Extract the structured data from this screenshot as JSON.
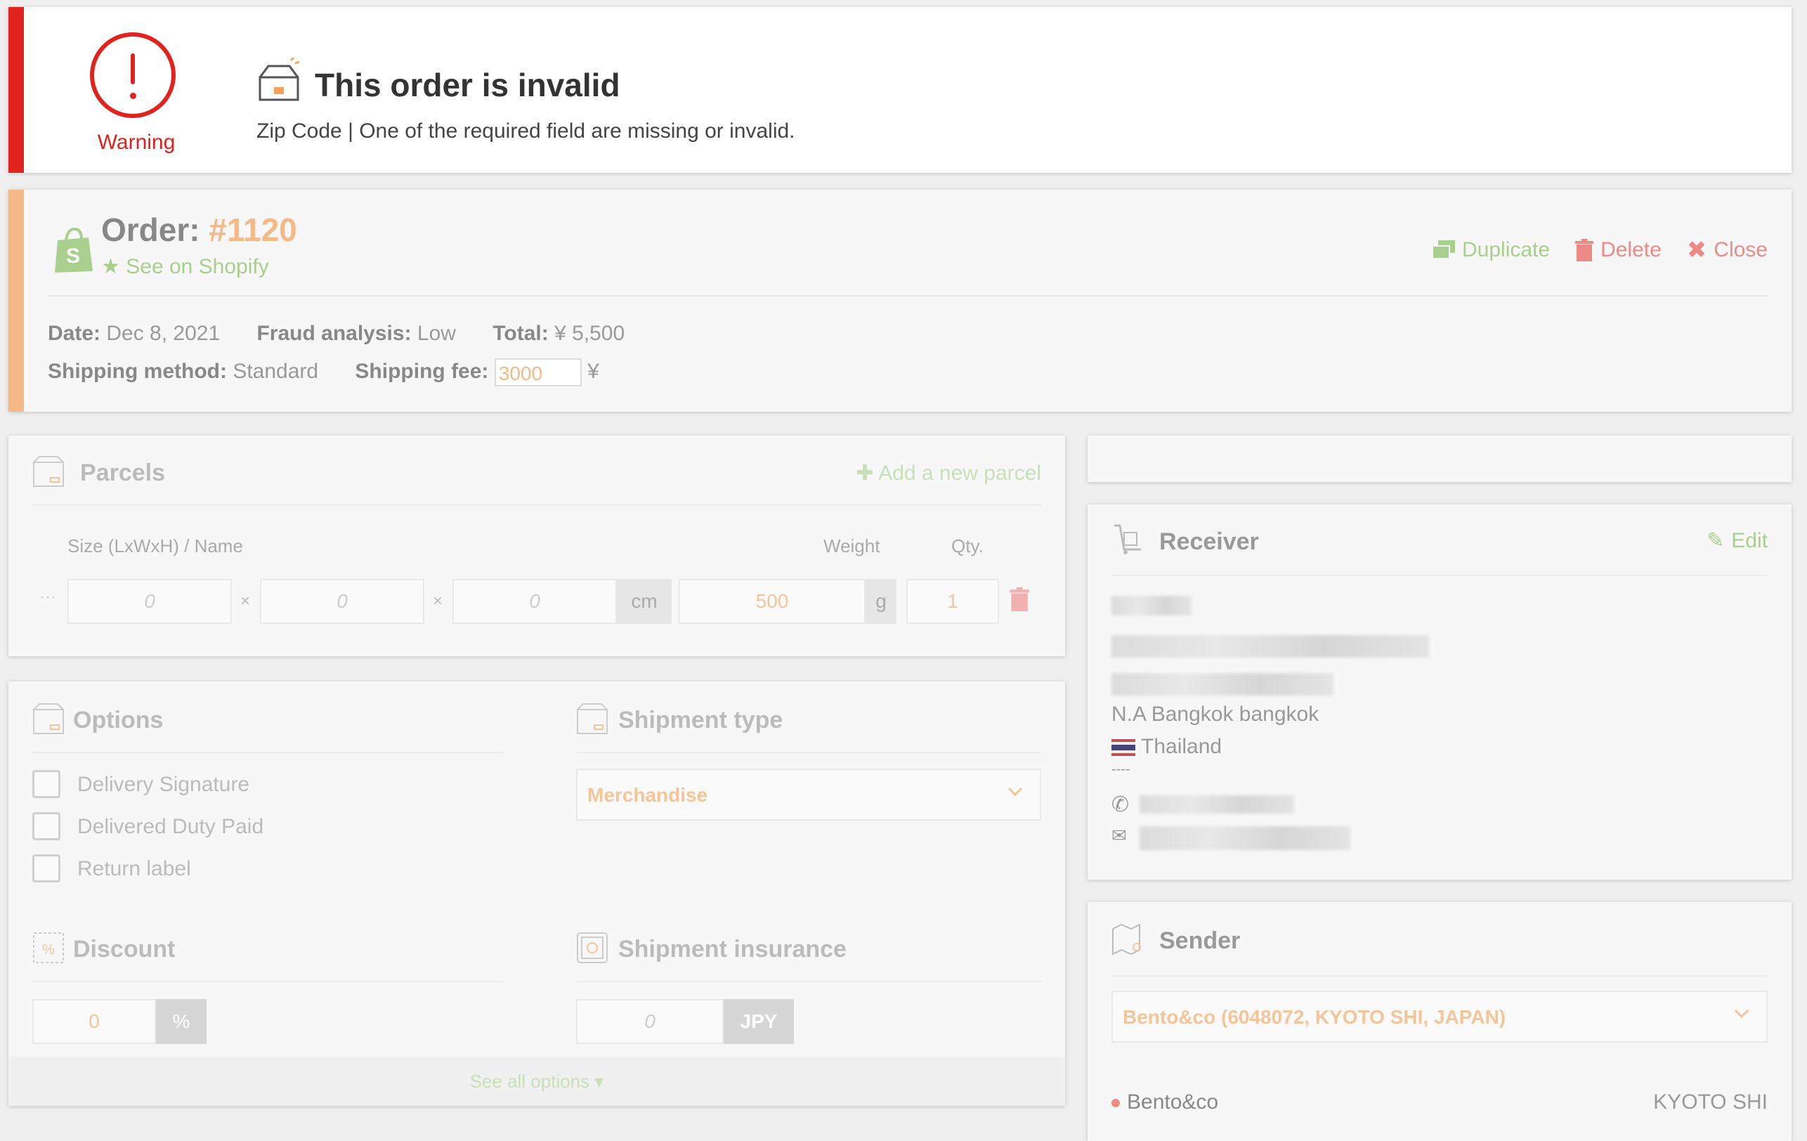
{
  "warning": {
    "label": "Warning",
    "title": "This order is invalid",
    "message": "Zip Code | One of the required field are missing or invalid."
  },
  "order": {
    "label": "Order:",
    "number": "#1120",
    "shopify_link": "See on Shopify",
    "actions": {
      "duplicate": "Duplicate",
      "delete": "Delete",
      "close": "Close"
    },
    "date_label": "Date:",
    "date": "Dec 8, 2021",
    "fraud_label": "Fraud analysis:",
    "fraud": "Low",
    "total_label": "Total:",
    "total": "¥ 5,500",
    "shipping_method_label": "Shipping method:",
    "shipping_method": "Standard",
    "shipping_fee_label": "Shipping fee:",
    "shipping_fee": "3000",
    "currency_symbol": "¥"
  },
  "parcels": {
    "title": "Parcels",
    "add_label": "Add a new parcel",
    "col_size": "Size (LxWxH) / Name",
    "col_weight": "Weight",
    "col_qty": "Qty.",
    "dots": "···",
    "length": "0",
    "width": "0",
    "height": "0",
    "times": "×",
    "dim_unit": "cm",
    "weight": "500",
    "weight_unit": "g",
    "qty": "1"
  },
  "options": {
    "title": "Options",
    "items": [
      "Delivery Signature",
      "Delivered Duty Paid",
      "Return label"
    ],
    "shipment_type_title": "Shipment type",
    "shipment_type": "Merchandise",
    "discount_title": "Discount",
    "discount_value": "0",
    "discount_unit": "%",
    "insurance_title": "Shipment insurance",
    "insurance_value": "0",
    "insurance_unit": "JPY",
    "see_all": "See all options ▾"
  },
  "receiver": {
    "title": "Receiver",
    "edit": "Edit",
    "city_line": "N.A Bangkok bangkok",
    "country": "Thailand",
    "separator": "----"
  },
  "sender": {
    "title": "Sender",
    "selected": "Bento&co (6048072, KYOTO SHI, JAPAN)",
    "name": "Bento&co",
    "city": "KYOTO SHI"
  },
  "colors": {
    "warning_red": "#e0231c",
    "order_accent": "#f5b987",
    "shopify_green": "#a8cf8e",
    "delete_red": "#ee8a86"
  }
}
